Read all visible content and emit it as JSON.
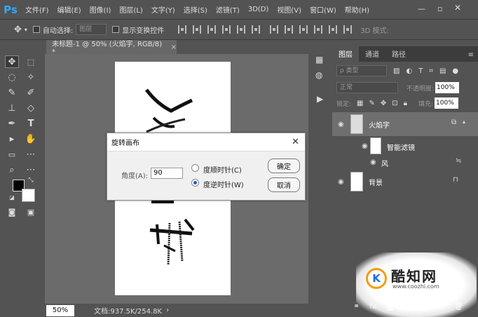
{
  "app": {
    "logo": "Ps",
    "menu": [
      "文件(F)",
      "编辑(E)",
      "图像(I)",
      "图层(L)",
      "文字(Y)",
      "选择(S)",
      "滤镜(T)",
      "3D(D)",
      "视图(V)",
      "窗口(W)",
      "帮助(H)"
    ],
    "window_controls": {
      "minimize": "—",
      "maximize": "▫",
      "close": "✕"
    }
  },
  "options_bar": {
    "move_icon": "move-icon",
    "auto_select_label": "自动选择:",
    "auto_select_value": "图层",
    "show_transform_label": "显示变换控件",
    "mode_3d_label": "3D 模式:"
  },
  "document": {
    "tab_title": "未标题-1 @ 50% (火焰字, RGB/8) *",
    "tab_close": "×"
  },
  "status": {
    "zoom": "50%",
    "doc_info": "文档:937.5K/254.8K",
    "arrow": "›"
  },
  "tools": [
    "move",
    "marquee",
    "lasso",
    "magic-wand",
    "eyedropper",
    "brush",
    "stamp",
    "eraser",
    "pen",
    "type",
    "path-select",
    "rectangle",
    "shape",
    "hand",
    "zoom",
    "more"
  ],
  "colors": {
    "foreground": "#000000",
    "background": "#ffffff",
    "accent": "#31a8ff"
  },
  "layers_panel": {
    "tabs": [
      "图层",
      "通道",
      "路径"
    ],
    "active_tab": 0,
    "filter_label": "ρ 类型",
    "blend_mode": "正常",
    "opacity_label": "不透明度:",
    "opacity_value": "100%",
    "lock_label": "锁定:",
    "fill_label": "填充:",
    "fill_value": "100%",
    "layers": [
      {
        "name": "火焰字",
        "type": "smart-object",
        "selected": true
      },
      {
        "name": "智能滤镜",
        "type": "smart-filter-group"
      },
      {
        "name": "风",
        "type": "filter"
      },
      {
        "name": "背景",
        "type": "background",
        "locked": true
      }
    ]
  },
  "dialog": {
    "title": "旋转画布",
    "close": "✕",
    "angle_label": "角度(A):",
    "angle_value": "90",
    "cw_label": "度顺时针(C)",
    "ccw_label": "度逆时针(W)",
    "selected": "ccw",
    "ok_label": "确定",
    "cancel_label": "取消"
  },
  "watermark": {
    "logo_text": "K",
    "name": "酷知网",
    "url": "www.coozhi.com"
  }
}
